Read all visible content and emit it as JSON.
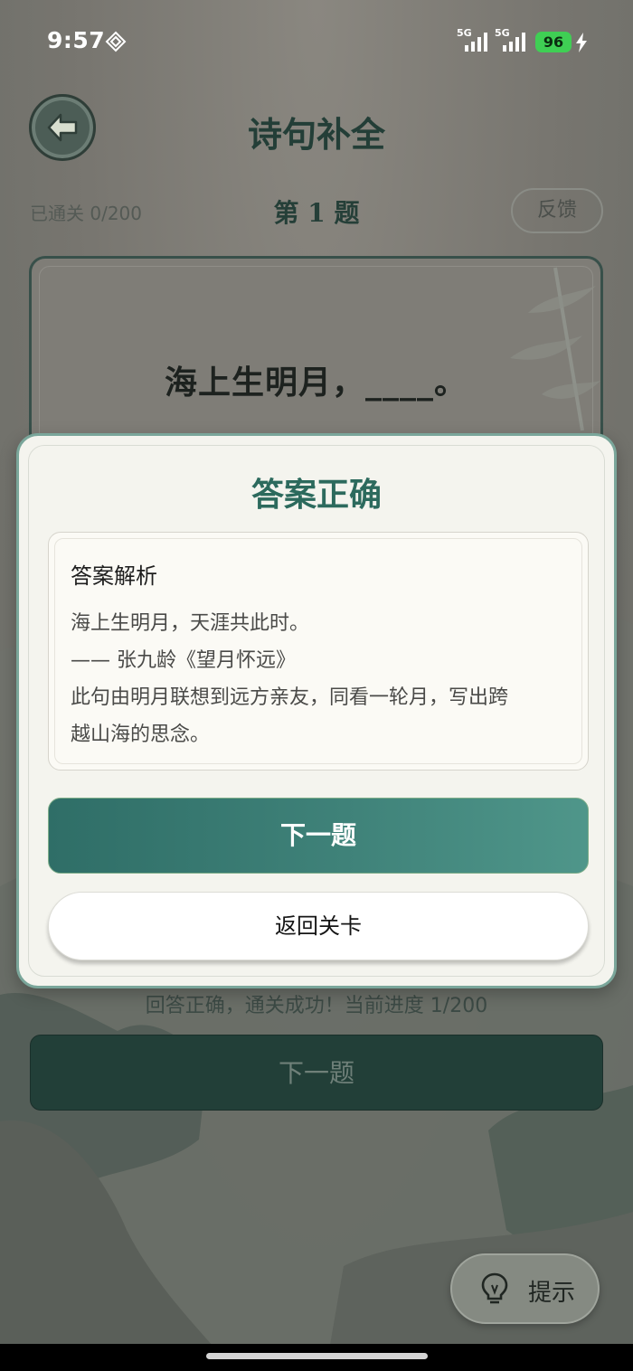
{
  "status_bar": {
    "time": "9:57",
    "signal_1_label": "5G",
    "signal_2_label": "5G",
    "battery": "96",
    "icons": [
      "vpn-icon",
      "signal-icon",
      "signal-icon",
      "battery-icon",
      "charging-icon"
    ]
  },
  "header": {
    "title": "诗句补全",
    "back_icon": "arrow-left-icon"
  },
  "progress": {
    "cleared": "已通关 0/200",
    "question_number": "第 1 题",
    "feedback_label": "反馈"
  },
  "question": {
    "text": "海上生明月，____。"
  },
  "modal": {
    "title": "答案正确",
    "analysis": {
      "heading": "答案解析",
      "lines": [
        "海上生明月，天涯共此时。",
        "—— 张九龄《望月怀远》",
        "此句由明月联想到远方亲友，同看一轮月，写出跨",
        "越山海的思念。"
      ]
    },
    "next_label": "下一题",
    "back_to_levels_label": "返回关卡"
  },
  "behind": {
    "result_message": "回答正确，通关成功！当前进度 1/200",
    "next_label": "下一题"
  },
  "hint": {
    "label": "提示",
    "icon": "lightbulb-icon"
  },
  "colors": {
    "accent": "#2c6a5d",
    "button_gradient_start": "#2f6e67",
    "battery": "#3fcf54"
  }
}
